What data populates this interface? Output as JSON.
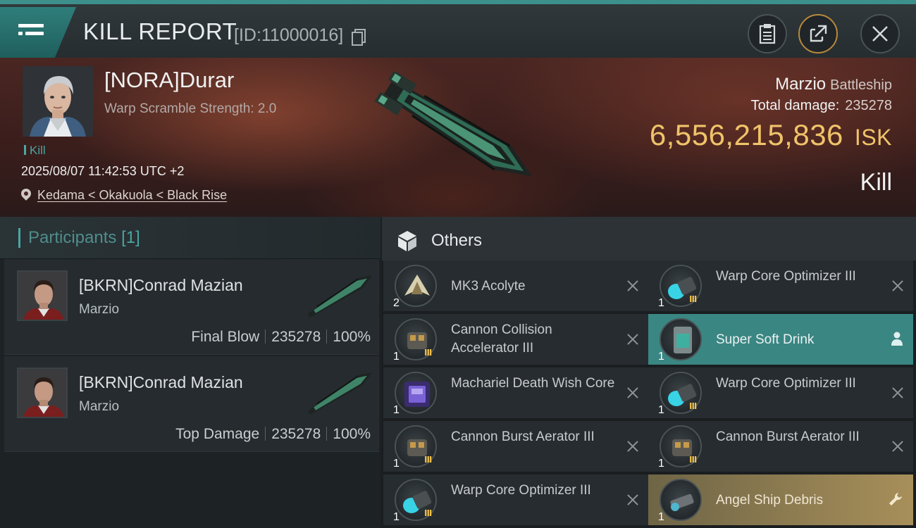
{
  "header": {
    "title": "KILL REPORT",
    "report_id": "[ID:11000016]"
  },
  "victim": {
    "name": "[NORA]Durar",
    "subtitle": "Warp Scramble Strength: 2.0",
    "tag": "Kill",
    "timestamp": "2025/08/07 11:42:53 UTC +2",
    "location": "Kedama < Okakuola < Black Rise",
    "ship_name": "Marzio",
    "ship_class": "Battleship",
    "total_damage_label": "Total damage:",
    "total_damage": "235278",
    "isk_value": "6,556,215,836",
    "isk_unit": "ISK",
    "result": "Kill"
  },
  "participants": {
    "label": "Participants",
    "count": "[1]",
    "rows": [
      {
        "name": "[BKRN]Conrad Mazian",
        "ship": "Marzio",
        "role": "Final Blow",
        "damage": "235278",
        "percent": "100%"
      },
      {
        "name": "[BKRN]Conrad Mazian",
        "ship": "Marzio",
        "role": "Top Damage",
        "damage": "235278",
        "percent": "100%"
      }
    ]
  },
  "others": {
    "label": "Others",
    "items": [
      {
        "name": "MK3  Acolyte",
        "qty": "2",
        "meta": "",
        "icon": "drone-icon"
      },
      {
        "name": "Warp Core Optimizer III",
        "qty": "1",
        "meta": "III",
        "icon": "optimizer-icon"
      },
      {
        "name": "Cannon Collision Accelerator III",
        "qty": "1",
        "meta": "III",
        "icon": "cannon-icon"
      },
      {
        "name": "Super Soft Drink",
        "qty": "1",
        "meta": "",
        "icon": "drink-icon"
      },
      {
        "name": "Machariel Death Wish Core",
        "qty": "1",
        "meta": "",
        "icon": "core-icon"
      },
      {
        "name": "Warp Core Optimizer III",
        "qty": "1",
        "meta": "III",
        "icon": "optimizer-icon"
      },
      {
        "name": "Cannon Burst Aerator III",
        "qty": "1",
        "meta": "III",
        "icon": "cannon-icon"
      },
      {
        "name": "Cannon Burst Aerator III",
        "qty": "1",
        "meta": "III",
        "icon": "cannon-icon"
      },
      {
        "name": "Warp Core Optimizer III",
        "qty": "1",
        "meta": "III",
        "icon": "optimizer-icon"
      },
      {
        "name": "Angel Ship Debris",
        "qty": "1",
        "meta": "",
        "icon": "debris-icon"
      }
    ]
  },
  "colors": {
    "accent_teal": "#3d8f8c",
    "isk_gold": "#f0c36a",
    "highlight_teal": "#3a8683",
    "highlight_gold": "#a88f5a"
  }
}
